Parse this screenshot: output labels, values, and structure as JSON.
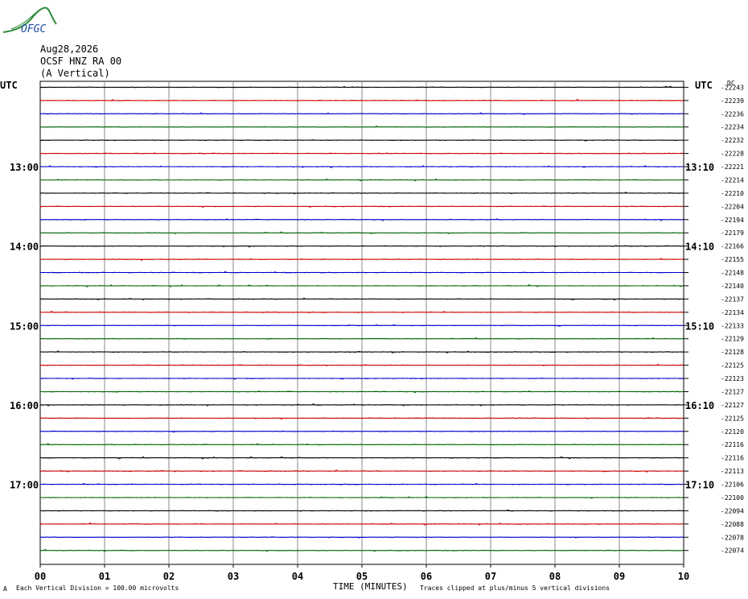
{
  "header": {
    "date": "Aug28,2026",
    "station": "OCSF HNZ RA 00",
    "component": "(A Vertical)",
    "utc_left": "UTC",
    "utc_right": "UTC",
    "dc_label": "DC"
  },
  "logo": {
    "text": "OFGC"
  },
  "footer": {
    "corner_mark": "A",
    "scale_note": "Each Vertical Division =  100.00 microvolts",
    "xlabel": "TIME (MINUTES)",
    "clip_note": "Traces clipped at plus/minus 5 vertical divisions"
  },
  "colors": {
    "trace_cycle": [
      "#000000",
      "#cc0000",
      "#0000cc",
      "#006600"
    ],
    "grid": "#888888"
  },
  "chart_data": {
    "type": "line",
    "title": "",
    "xlabel": "TIME (MINUTES)",
    "ylabel": "",
    "xlim": [
      0,
      10
    ],
    "x_ticks": [
      "00",
      "01",
      "02",
      "03",
      "04",
      "05",
      "06",
      "07",
      "08",
      "09",
      "10"
    ],
    "rows_per_hour": 6,
    "minutes_per_row": 10,
    "left_time_labels": [
      {
        "row": 6,
        "label": "13:00"
      },
      {
        "row": 12,
        "label": "14:00"
      },
      {
        "row": 18,
        "label": "15:00"
      },
      {
        "row": 24,
        "label": "16:00"
      },
      {
        "row": 30,
        "label": "17:00"
      }
    ],
    "right_time_labels": [
      {
        "row": 6,
        "label": "13:10"
      },
      {
        "row": 12,
        "label": "14:10"
      },
      {
        "row": 18,
        "label": "15:10"
      },
      {
        "row": 24,
        "label": "16:10"
      },
      {
        "row": 30,
        "label": "17:10"
      }
    ],
    "dc_offsets": [
      -22243,
      -22239,
      -22236,
      -22234,
      -22232,
      -22228,
      -22221,
      -22214,
      -22210,
      -22204,
      -22194,
      -22179,
      -22166,
      -22155,
      -22148,
      -22140,
      -22137,
      -22134,
      -22133,
      -22129,
      -22128,
      -22125,
      -22123,
      -22127,
      -22127,
      -22125,
      -22120,
      -22116,
      -22116,
      -22113,
      -22106,
      -22100,
      -22094,
      -22088,
      -22078,
      -22074
    ],
    "grid": true
  }
}
